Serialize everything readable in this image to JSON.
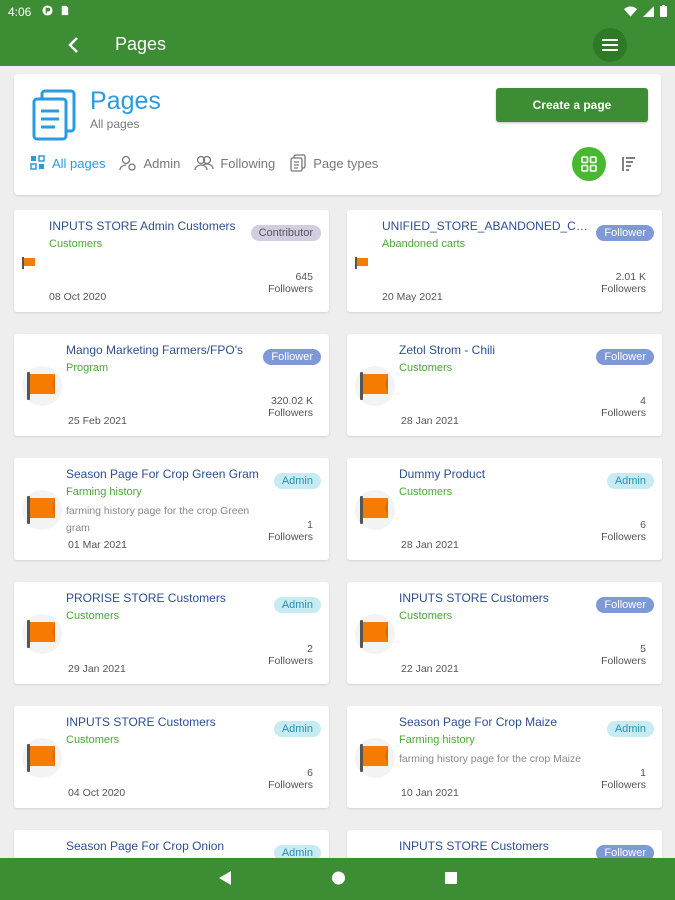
{
  "status_bar": {
    "time": "4:06"
  },
  "app_bar": {
    "title": "Pages"
  },
  "header": {
    "title": "Pages",
    "subtitle": "All pages",
    "create_button": "Create a page",
    "filters": [
      {
        "label": "All pages",
        "active": true
      },
      {
        "label": "Admin",
        "active": false
      },
      {
        "label": "Following",
        "active": false
      },
      {
        "label": "Page types",
        "active": false
      }
    ]
  },
  "cards": [
    {
      "name": "INPUTS STORE Admin Customers",
      "type": "Customers",
      "description": "",
      "date": "08 Oct 2020",
      "role": "Contributor",
      "count": "645",
      "count_label": "Followers",
      "icon": "flag-small"
    },
    {
      "name": "UNIFIED_STORE_ABANDONED_CA...",
      "type": "Abandoned carts",
      "description": "",
      "date": "20 May 2021",
      "role": "Follower",
      "count": "2.01 K",
      "count_label": "Followers",
      "icon": "flag-small"
    },
    {
      "name": "Mango Marketing Farmers/FPO's",
      "type": "Program",
      "description": "",
      "date": "25 Feb 2021",
      "role": "Follower",
      "count": "320.02 K",
      "count_label": "Followers",
      "icon": "flag-large"
    },
    {
      "name": "Zetol Strom - Chili",
      "type": "Customers",
      "description": "",
      "date": "28 Jan 2021",
      "role": "Follower",
      "count": "4",
      "count_label": "Followers",
      "icon": "flag-large"
    },
    {
      "name": "Season Page For Crop Green Gram",
      "type": "Farming history",
      "description": "farming history page for the crop Green gram",
      "date": "01 Mar 2021",
      "role": "Admin",
      "count": "1",
      "count_label": "Followers",
      "icon": "flag-large"
    },
    {
      "name": "Dummy Product",
      "type": "Customers",
      "description": "",
      "date": "28 Jan 2021",
      "role": "Admin",
      "count": "6",
      "count_label": "Followers",
      "icon": "flag-large"
    },
    {
      "name": "PRORISE STORE Customers",
      "type": "Customers",
      "description": "",
      "date": "29 Jan 2021",
      "role": "Admin",
      "count": "2",
      "count_label": "Followers",
      "icon": "flag-large"
    },
    {
      "name": "INPUTS STORE Customers",
      "type": "Customers",
      "description": "",
      "date": "22 Jan 2021",
      "role": "Follower",
      "count": "5",
      "count_label": "Followers",
      "icon": "flag-large"
    },
    {
      "name": "INPUTS STORE Customers",
      "type": "Customers",
      "description": "",
      "date": "04 Oct 2020",
      "role": "Admin",
      "count": "6",
      "count_label": "Followers",
      "icon": "flag-large"
    },
    {
      "name": "Season Page For Crop Maize",
      "type": "Farming history",
      "description": "farming history page for the crop Maize",
      "date": "10 Jan 2021",
      "role": "Admin",
      "count": "1",
      "count_label": "Followers",
      "icon": "flag-large"
    },
    {
      "name": "Season Page For Crop Onion",
      "type": "",
      "description": "",
      "date": "",
      "role": "Admin",
      "count": "",
      "count_label": "",
      "icon": "flag-large"
    },
    {
      "name": "INPUTS STORE Customers",
      "type": "",
      "description": "",
      "date": "",
      "role": "Follower",
      "count": "",
      "count_label": "",
      "icon": "flag-large"
    }
  ],
  "colors": {
    "primary": "#3c8d33",
    "accent": "#2a9be0",
    "grid_toggle": "#47b82f",
    "flag": "#f57c00"
  }
}
